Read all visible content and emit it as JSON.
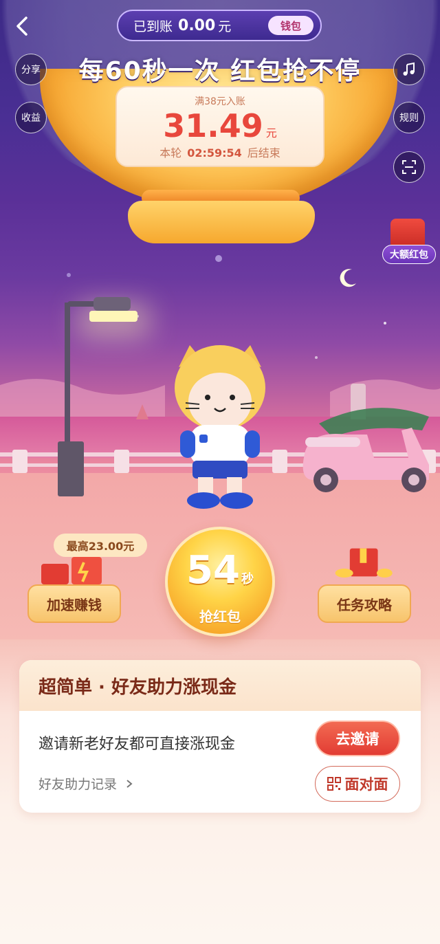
{
  "top_bar": {
    "received_label": "已到账",
    "received_amount": "0.00",
    "currency": "元",
    "wallet_label": "钱包"
  },
  "headline": "每60秒一次 红包抢不停",
  "side_buttons": {
    "share": "分享",
    "earnings": "收益",
    "rules": "规则"
  },
  "amount_card": {
    "condition": "满38元入账",
    "amount": "31.49",
    "unit": "元",
    "round_label": "本轮",
    "countdown": "02:59:54",
    "end_label": "后结束"
  },
  "big_red_packet": "大额红包",
  "actions": {
    "max_tag": "最高23.00元",
    "speed_up": "加速赚钱",
    "countdown_seconds": "54",
    "seconds_unit": "秒",
    "grab": "抢红包",
    "tasks": "任务攻略"
  },
  "invite_card": {
    "title": "超简单 · 好友助力涨现金",
    "desc": "邀请新老好友都可直接涨现金",
    "record_link": "好友助力记录",
    "invite_btn": "去邀请",
    "face_to_face_btn": "面对面"
  },
  "colors": {
    "accent_red": "#e8473c",
    "brand_purple": "#4a2f94",
    "gold": "#f7a72a"
  },
  "icons": [
    "back-icon",
    "music-icon",
    "scan-icon",
    "qr-code-icon",
    "chevron-right-icon"
  ]
}
